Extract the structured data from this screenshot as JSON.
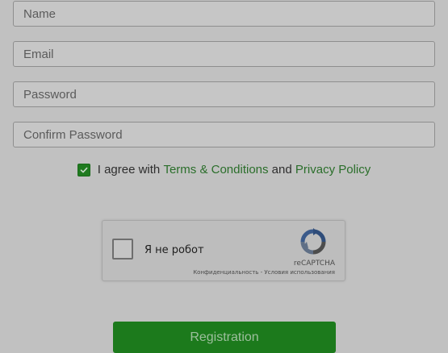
{
  "form": {
    "fields": {
      "name": {
        "placeholder": "Name",
        "value": ""
      },
      "email": {
        "placeholder": "Email",
        "value": ""
      },
      "password": {
        "placeholder": "Password",
        "value": ""
      },
      "confirm_password": {
        "placeholder": "Confirm Password",
        "value": ""
      }
    },
    "agreement": {
      "checked": true,
      "prefix": "I agree with ",
      "terms_link": "Terms & Conditions",
      "conjunction": " and ",
      "privacy_link": "Privacy Policy"
    },
    "submit_label": "Registration"
  },
  "recaptcha": {
    "label": "Я не робот",
    "brand": "reCAPTCHA",
    "privacy_link": "Конфиденциальность",
    "separator": " - ",
    "terms_link": "Условия использования"
  },
  "colors": {
    "accent_green": "#1c7a1c",
    "link_green": "#2a6e2a",
    "overlay_gray": "#c1c1c1"
  },
  "icons": {
    "agree_checkbox": "checkmark-icon",
    "recaptcha_logo": "recaptcha-logo-icon"
  }
}
